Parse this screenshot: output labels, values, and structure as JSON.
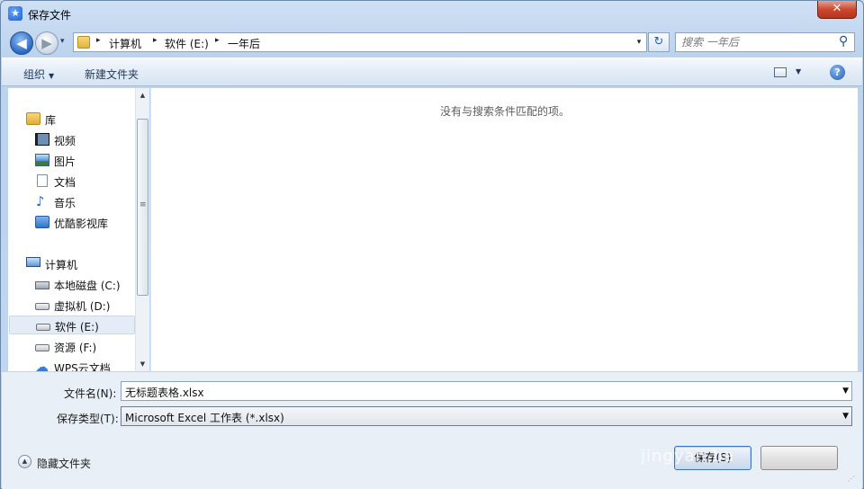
{
  "window": {
    "title": "保存文件",
    "close_label": "✕"
  },
  "nav": {
    "back_icon": "◀",
    "forward_icon": "▶",
    "history_drop": "▾"
  },
  "address": {
    "separators": [
      "▸",
      "▸",
      "▸"
    ],
    "segments": [
      "计算机",
      "软件 (E:)",
      "一年后"
    ],
    "dropdown": "▾"
  },
  "refresh_label": "↻",
  "search": {
    "placeholder": "搜索 一年后",
    "icon": "⚲"
  },
  "toolbar": {
    "organize": "组织",
    "new_folder": "新建文件夹",
    "help": "?"
  },
  "nav_pane": {
    "library": "库",
    "library_items": [
      "视频",
      "图片",
      "文档",
      "音乐",
      "优酷影视库"
    ],
    "computer": "计算机",
    "drives": [
      "本地磁盘 (C:)",
      "虚拟机 (D:)",
      "软件 (E:)",
      "资源 (F:)",
      "WPS云文档"
    ],
    "selected": "软件 (E:)"
  },
  "content": {
    "empty_message": "没有与搜索条件匹配的项。"
  },
  "form": {
    "filename_label": "文件名(N):",
    "filename_value": "无标题表格.xlsx",
    "filetype_label": "保存类型(T):",
    "filetype_value": "Microsoft Excel 工作表 (*.xlsx)"
  },
  "footer": {
    "hide_folders": "隐藏文件夹",
    "save": "保存(S)",
    "cancel": "",
    "watermark": "jingyan.ba"
  },
  "colors": {
    "accent": "#3b72c7",
    "close": "#c9492f",
    "selected": "#e4ecf7"
  }
}
